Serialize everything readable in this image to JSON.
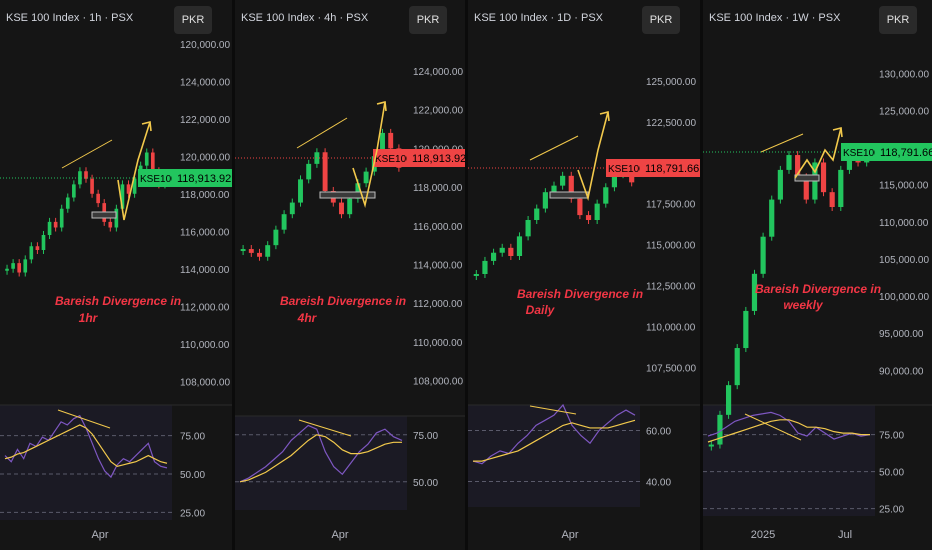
{
  "colors": {
    "background": "#151515",
    "up": "#22c55e",
    "down": "#ef4444",
    "annotation": "#f2c94c",
    "rsi_line": "#7e57c2",
    "rsi_ma": "#f2c94c",
    "divergence_text": "#f23645",
    "axis_text": "#b2b5be"
  },
  "currency_label": "PKR",
  "chart_data": [
    {
      "type": "candlestick",
      "title": "KSE 100 Index · 1h · PSX",
      "timeframe": "1h",
      "symbol": "KSE100",
      "last_price": "118,913.92",
      "last_price_color": "#22c55e",
      "y_ticks": [
        "120,000.00",
        "122,000.00",
        "124,000.00",
        "120,000.00",
        "118,000.00",
        "116,000.00",
        "114,000.00",
        "112,000.00",
        "110,000.00",
        "108,000.00"
      ],
      "price_ticks": [
        {
          "label": "120,000.00",
          "value": 126000
        },
        {
          "label": "124,000.00",
          "value": 124000
        },
        {
          "label": "122,000.00",
          "value": 122000
        },
        {
          "label": "120,000.00",
          "value": 120000
        },
        {
          "label": "118,000.00",
          "value": 118000
        },
        {
          "label": "116,000.00",
          "value": 116000
        },
        {
          "label": "114,000.00",
          "value": 114000
        },
        {
          "label": "112,000.00",
          "value": 112000
        },
        {
          "label": "110,000.00",
          "value": 110000
        },
        {
          "label": "108,000.00",
          "value": 108000
        }
      ],
      "ylim": [
        107000,
        126200
      ],
      "price_path": [
        114000,
        114300,
        113800,
        114500,
        115200,
        115000,
        115800,
        116500,
        116200,
        117200,
        117800,
        118500,
        119200,
        118800,
        118000,
        117500,
        116500,
        116200,
        117200,
        118500,
        118000,
        118800,
        119500,
        120200,
        119200,
        118500,
        118900
      ],
      "rsi_ticks": [
        {
          "label": "75.00",
          "value": 75
        },
        {
          "label": "50.00",
          "value": 50
        },
        {
          "label": "25.00",
          "value": 25
        }
      ],
      "rsi_path": [
        62,
        58,
        66,
        60,
        70,
        68,
        74,
        72,
        78,
        84,
        82,
        86,
        88,
        80,
        70,
        60,
        52,
        48,
        56,
        60,
        58,
        62,
        66,
        70,
        58,
        55,
        54
      ],
      "rsi_ma_path": [
        60,
        61,
        63,
        64,
        66,
        68,
        70,
        72,
        74,
        76,
        78,
        80,
        82,
        80,
        76,
        70,
        64,
        58,
        55,
        56,
        57,
        58,
        60,
        62,
        60,
        58,
        57
      ],
      "x_label": "Apr",
      "annotation_text": [
        "Bareish Divergence in",
        "1hr"
      ]
    },
    {
      "type": "candlestick",
      "title": "KSE 100 Index · 4h · PSX",
      "timeframe": "4h",
      "symbol": "KSE100",
      "last_price": "118,913.92",
      "last_price_color": "#ef4444",
      "price_ticks": [
        {
          "label": "124,000.00",
          "value": 124000
        },
        {
          "label": "122,000.00",
          "value": 122000
        },
        {
          "label": "120,000.00",
          "value": 120000
        },
        {
          "label": "118,000.00",
          "value": 118000
        },
        {
          "label": "116,000.00",
          "value": 116000
        },
        {
          "label": "114,000.00",
          "value": 114000
        },
        {
          "label": "112,000.00",
          "value": 112000
        },
        {
          "label": "110,000.00",
          "value": 110000
        },
        {
          "label": "108,000.00",
          "value": 108000
        }
      ],
      "ylim": [
        107000,
        125600
      ],
      "price_path": [
        114800,
        114600,
        114400,
        115000,
        115800,
        116600,
        117200,
        118400,
        119200,
        119800,
        117800,
        117200,
        116600,
        117400,
        118200,
        118800,
        119600,
        120800,
        120000,
        119000
      ],
      "rsi_ticks": [
        {
          "label": "75.00",
          "value": 75
        },
        {
          "label": "50.00",
          "value": 50
        }
      ],
      "rsi_path": [
        50,
        52,
        55,
        58,
        62,
        66,
        72,
        76,
        80,
        78,
        66,
        58,
        54,
        60,
        66,
        70,
        76,
        78,
        74,
        72
      ],
      "rsi_ma_path": [
        50,
        51,
        53,
        55,
        58,
        61,
        64,
        68,
        72,
        75,
        74,
        71,
        67,
        65,
        65,
        66,
        68,
        70,
        71,
        71
      ],
      "x_label": "Apr",
      "annotation_text": [
        "Bareish Divergence in",
        "4hr"
      ]
    },
    {
      "type": "candlestick",
      "title": "KSE 100 Index · 1D · PSX",
      "timeframe": "1D",
      "symbol": "KSE100",
      "last_price": "118,791.66",
      "last_price_color": "#ef4444",
      "price_ticks": [
        {
          "label": "125,000.00",
          "value": 125000
        },
        {
          "label": "122,500.00",
          "value": 122500
        },
        {
          "label": "120,000.00",
          "value": 120000
        },
        {
          "label": "117,500.00",
          "value": 117500
        },
        {
          "label": "115,000.00",
          "value": 115000
        },
        {
          "label": "112,500.00",
          "value": 112500
        },
        {
          "label": "110,000.00",
          "value": 110000
        },
        {
          "label": "107,500.00",
          "value": 107500
        }
      ],
      "ylim": [
        105500,
        127500
      ],
      "price_path": [
        113200,
        114000,
        114500,
        114800,
        114300,
        115500,
        116500,
        117200,
        118200,
        118600,
        119200,
        117800,
        116800,
        116500,
        117500,
        118500,
        119300,
        119800,
        118800
      ],
      "rsi_ticks": [
        {
          "label": "60.00",
          "value": 60
        },
        {
          "label": "40.00",
          "value": 40
        }
      ],
      "rsi_path": [
        48,
        47,
        50,
        52,
        51,
        55,
        58,
        62,
        64,
        66,
        70,
        62,
        58,
        55,
        60,
        63,
        66,
        68,
        66
      ],
      "rsi_ma_path": [
        48,
        48,
        49,
        50,
        51,
        52,
        54,
        56,
        58,
        60,
        62,
        63,
        62,
        61,
        61,
        61,
        62,
        63,
        64
      ],
      "x_label": "Apr",
      "annotation_text": [
        "Bareish Divergence in",
        "Daily"
      ]
    },
    {
      "type": "candlestick",
      "title": "KSE 100 Index · 1W · PSX",
      "timeframe": "1W",
      "symbol": "KSE100",
      "last_price": "118,791.66",
      "last_price_color": "#22c55e",
      "price_ticks": [
        {
          "label": "130,000.00",
          "value": 130000
        },
        {
          "label": "125,000.00",
          "value": 125000
        },
        {
          "label": "120,000.00",
          "value": 120000
        },
        {
          "label": "115,000.00",
          "value": 115000
        },
        {
          "label": "110,000.00",
          "value": 110000
        },
        {
          "label": "105,000.00",
          "value": 105000
        },
        {
          "label": "100,000.00",
          "value": 100000
        },
        {
          "label": "95,000.00",
          "value": 95000
        },
        {
          "label": "90,000.00",
          "value": 90000
        }
      ],
      "ylim": [
        86000,
        134500
      ],
      "price_path": [
        80000,
        84000,
        88000,
        93000,
        98000,
        103000,
        108000,
        113000,
        117000,
        119000,
        116000,
        113000,
        118000,
        114000,
        112000,
        117000,
        119500,
        118000,
        118800
      ],
      "rsi_ticks": [
        {
          "label": "75.00",
          "value": 75
        },
        {
          "label": "50.00",
          "value": 50
        },
        {
          "label": "25.00",
          "value": 25
        }
      ],
      "rsi_path": [
        74,
        76,
        80,
        84,
        86,
        88,
        89,
        90,
        88,
        84,
        76,
        74,
        80,
        76,
        72,
        74,
        76,
        74,
        75
      ],
      "rsi_ma_path": [
        70,
        72,
        74,
        76,
        78,
        80,
        82,
        84,
        85,
        85,
        83,
        80,
        80,
        79,
        77,
        76,
        76,
        75,
        75
      ],
      "x_labels": [
        "2025",
        "Jul"
      ],
      "annotation_text": [
        "Bareish Divergence in",
        "weekly"
      ]
    }
  ]
}
